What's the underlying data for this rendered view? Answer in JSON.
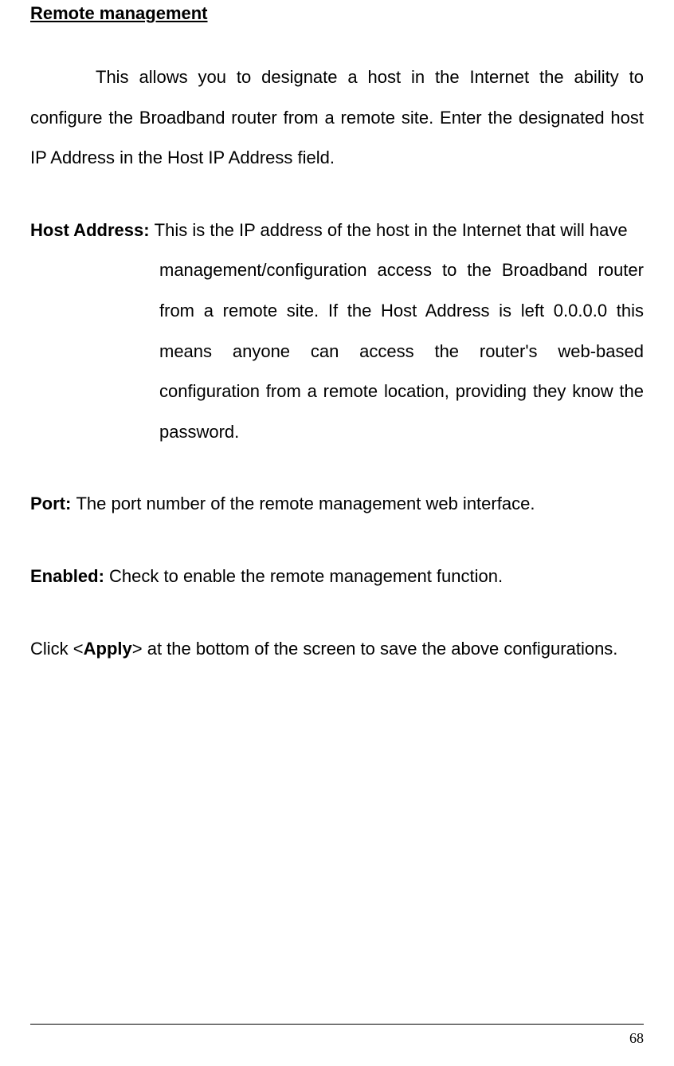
{
  "section": {
    "title": "Remote management",
    "intro": "This allows you to designate a host in the Internet the ability to configure the Broadband router from a remote site. Enter the designated host IP Address in the Host IP Address field."
  },
  "definitions": {
    "hostAddress": {
      "term": "Host Address: ",
      "firstLine": "This is the IP address of the host in the Internet that will have",
      "rest": "management/configuration access to the Broadband router from a remote site. If the Host Address is left 0.0.0.0 this means anyone can access the router's web-based configuration from a remote location, providing they know the password."
    },
    "port": {
      "term": "Port: ",
      "text": "The port number of the remote management web interface."
    },
    "enabled": {
      "term": "Enabled: ",
      "text": "Check to enable the remote management function."
    }
  },
  "apply": {
    "prefix": "Click <",
    "bold": "Apply",
    "suffix": "> at the bottom of the screen to save the above configurations."
  },
  "pageNumber": "68"
}
